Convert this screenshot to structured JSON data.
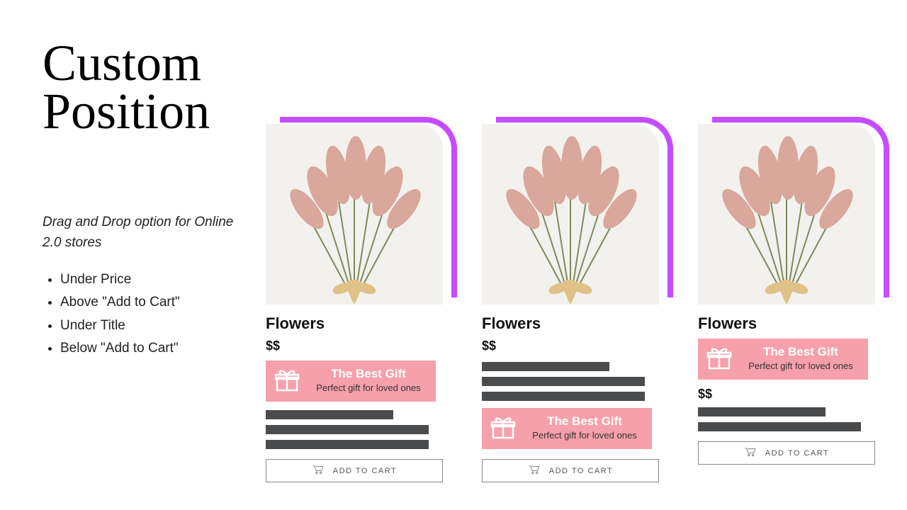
{
  "heading_line1": "Custom",
  "heading_line2": "Position",
  "subtext": "Drag and Drop option for Online 2.0 stores",
  "bullets": [
    "Under Price",
    "Above \"Add to Cart\"",
    "Under Title",
    "Below \"Add to Cart\""
  ],
  "product": {
    "title": "Flowers",
    "price": "$$",
    "add_to_cart_label": "ADD TO CART"
  },
  "badge": {
    "title": "The Best Gift",
    "subtitle": "Perfect gift for loved ones"
  },
  "accent_color": "#c44dff",
  "badge_color": "#f5a0aa",
  "cards": [
    {
      "layout": "under_price"
    },
    {
      "layout": "above_add_to_cart"
    },
    {
      "layout": "under_title"
    }
  ]
}
